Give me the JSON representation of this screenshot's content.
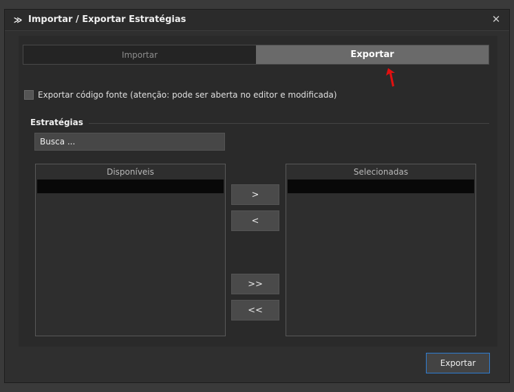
{
  "window": {
    "title": "Importar / Exportar Estratégias",
    "close_glyph": "✕",
    "app_icon_glyph": "≫"
  },
  "tabs": [
    {
      "label": "Importar",
      "active": false
    },
    {
      "label": "Exportar",
      "active": true
    }
  ],
  "export_source": {
    "label": "Exportar código fonte (atenção: pode ser aberta no editor e modificada)",
    "checked": false
  },
  "strategies": {
    "group_title": "Estratégias",
    "search_placeholder": "Busca ...",
    "available_header": "Disponíveis",
    "selected_header": "Selecionadas",
    "buttons": {
      "add": ">",
      "remove": "<",
      "add_all": ">>",
      "remove_all": "<<"
    }
  },
  "footer": {
    "export_label": "Exportar"
  },
  "colors": {
    "annotation_arrow": "#e11010",
    "focus_border": "#2f7fd6",
    "active_tab": "#6a6a6a"
  }
}
